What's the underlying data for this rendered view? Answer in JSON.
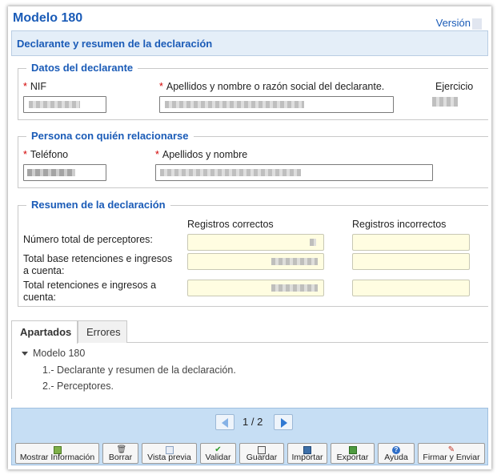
{
  "app": {
    "title": "Modelo 180",
    "version_label": "Versión"
  },
  "section": {
    "title": "Declarante y resumen de la declaración"
  },
  "declarante": {
    "legend": "Datos del declarante",
    "nif_label": "NIF",
    "nombre_label": "Apellidos y nombre o razón social del declarante.",
    "ejercicio_label": "Ejercicio"
  },
  "persona": {
    "legend": "Persona con quién relacionarse",
    "telefono_label": "Teléfono",
    "nombre_label": "Apellidos y nombre"
  },
  "resumen": {
    "legend": "Resumen de la declaración",
    "col_correctos": "Registros correctos",
    "col_incorrectos": "Registros incorrectos",
    "rows": [
      {
        "label": "Número total de perceptores:"
      },
      {
        "label": "Total base retenciones e ingresos a cuenta:"
      },
      {
        "label": "Total retenciones e ingresos a cuenta:"
      }
    ]
  },
  "tabs": [
    {
      "label": "Apartados",
      "active": true
    },
    {
      "label": "Errores",
      "active": false
    }
  ],
  "tree": {
    "root": "Modelo 180",
    "items": [
      "1.- Declarante y resumen de la declaración.",
      "2.- Perceptores."
    ]
  },
  "pager": {
    "current": "1",
    "separator": "/",
    "total": "2"
  },
  "toolbar": [
    {
      "label": "Mostrar Información",
      "icon": "info-window-icon"
    },
    {
      "label": "Borrar",
      "icon": "trash-icon"
    },
    {
      "label": "Vista previa",
      "icon": "document-preview-icon"
    },
    {
      "label": "Validar",
      "icon": "checkmark-icon"
    },
    {
      "label": "Guardar",
      "icon": "save-icon"
    },
    {
      "label": "Importar",
      "icon": "import-icon"
    },
    {
      "label": "Exportar",
      "icon": "export-icon"
    },
    {
      "label": "Ayuda",
      "icon": "help-icon"
    },
    {
      "label": "Firmar y Enviar",
      "icon": "sign-send-icon"
    }
  ],
  "colors": {
    "accent": "#1a5bb7",
    "required": "#d20000",
    "toolbar_bg": "#c6def4",
    "readonly_bg": "#fffde1"
  }
}
